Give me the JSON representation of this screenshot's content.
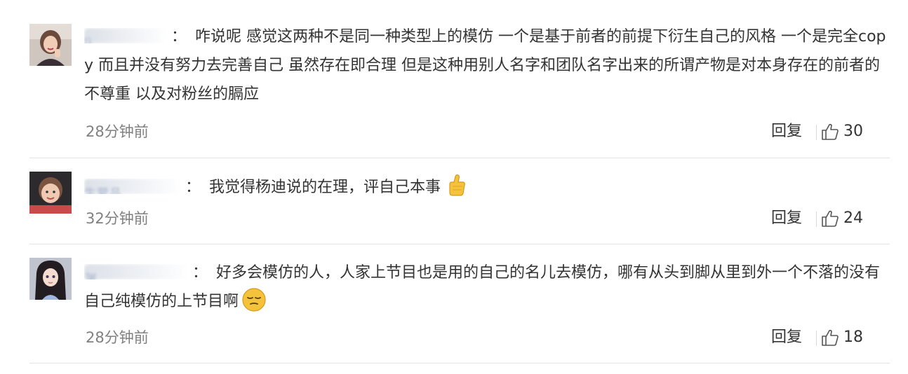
{
  "comments": [
    {
      "username": "lì",
      "separator": "：",
      "text": "咋说呢 感觉这两种不是同一种类型上的模仿 一个是基于前者的前提下衍生自己的风格 一个是完全copy 而且并没有努力去完善自己 虽然存在即合理 但是这种用别人名字和团队名字出来的所谓产物是对本身存在的前者的不尊重 以及对粉丝的膈应",
      "time": "28分钟前",
      "reply_label": "回复",
      "likes": "30",
      "avatar_icon": "avatar-girl-peace-sign"
    },
    {
      "username": "生蒙品",
      "separator": "：",
      "text": "我觉得杨迪说的在理，评自己本事",
      "emoji": "thumbs-up-emoji",
      "time": "32分钟前",
      "reply_label": "回复",
      "likes": "24",
      "avatar_icon": "avatar-child"
    },
    {
      "username": "渊",
      "separator": "：",
      "text": "好多会模仿的人，人家上节目也是用的自己的名儿去模仿，哪有从头到脚从里到外一个不落的没有自己纯模仿的上节目啊",
      "emoji": "sleepy-face-emoji",
      "time": "28分钟前",
      "reply_label": "回复",
      "likes": "18",
      "avatar_icon": "avatar-cartoon-girl"
    }
  ],
  "colors": {
    "text": "#333333",
    "meta": "#808080",
    "divider": "#e3e3e3",
    "emoji": "#f5c33b"
  },
  "icons": {
    "like": "thumbs-up-outline-icon"
  }
}
